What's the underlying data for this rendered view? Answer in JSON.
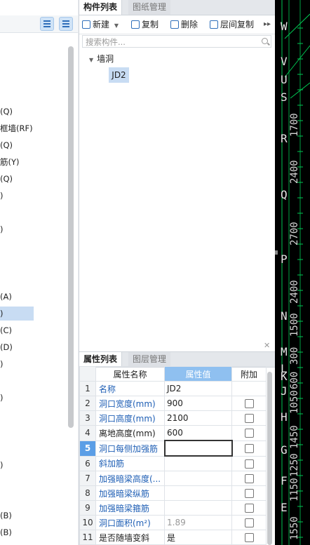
{
  "left_panel": {
    "tree_items": [
      "(Q)",
      "框墙(RF)",
      "(Q)",
      "筋(Y)",
      "(Q)",
      ")",
      ")",
      "(A)",
      ")",
      "(C)",
      "(D)",
      ")",
      ")",
      ")",
      "(B)",
      "(B)"
    ]
  },
  "component_panel": {
    "tabs": [
      "构件列表",
      "图纸管理"
    ],
    "toolbar": {
      "new": "新建",
      "copy": "复制",
      "delete": "删除",
      "floor_copy": "层间复制"
    },
    "search": {
      "placeholder": "搜索构件..."
    },
    "tree": {
      "group": "墙洞",
      "item": "JD2"
    }
  },
  "property_panel": {
    "tabs": [
      "属性列表",
      "图层管理"
    ],
    "headers": {
      "name": "属性名称",
      "value": "属性值",
      "extra": "附加"
    },
    "rows": [
      {
        "num": "1",
        "name": "名称",
        "value": "JD2",
        "blue": true,
        "checkbox": false
      },
      {
        "num": "2",
        "name": "洞口宽度(mm)",
        "value": "900",
        "blue": true,
        "checkbox": true
      },
      {
        "num": "3",
        "name": "洞口高度(mm)",
        "value": "2100",
        "blue": true,
        "checkbox": true
      },
      {
        "num": "4",
        "name": "离地高度(mm)",
        "value": "600",
        "blue": false,
        "checkbox": true
      },
      {
        "num": "5",
        "name": "洞口每侧加强筋",
        "value": "",
        "blue": true,
        "checkbox": true
      },
      {
        "num": "6",
        "name": "斜加筋",
        "value": "",
        "blue": true,
        "checkbox": true
      },
      {
        "num": "7",
        "name": "加强暗梁高度(...",
        "value": "",
        "blue": true,
        "checkbox": true
      },
      {
        "num": "8",
        "name": "加强暗梁纵筋",
        "value": "",
        "blue": true,
        "checkbox": true
      },
      {
        "num": "9",
        "name": "加强暗梁箍筋",
        "value": "",
        "blue": true,
        "checkbox": true
      },
      {
        "num": "10",
        "name": "洞口面积(m²)",
        "value": "1.89",
        "blue": true,
        "checkbox": true
      },
      {
        "num": "11",
        "name": "是否随墙变斜",
        "value": "是",
        "blue": false,
        "checkbox": true
      }
    ]
  },
  "cad": {
    "axis_labels": [
      "W",
      "V",
      "U",
      "S",
      "R",
      "Q",
      "P",
      "N",
      "M",
      "L",
      "K",
      "J",
      "H",
      "G",
      "F",
      "E"
    ],
    "dimensions": [
      "1700",
      "2400",
      "2700",
      "2400",
      "1500",
      "300",
      "600",
      "1050",
      "1450",
      "1250",
      "1150",
      "1550"
    ],
    "colors": {
      "background": "#000000",
      "lines": "#00c853",
      "text": "#e6e6e6"
    }
  }
}
